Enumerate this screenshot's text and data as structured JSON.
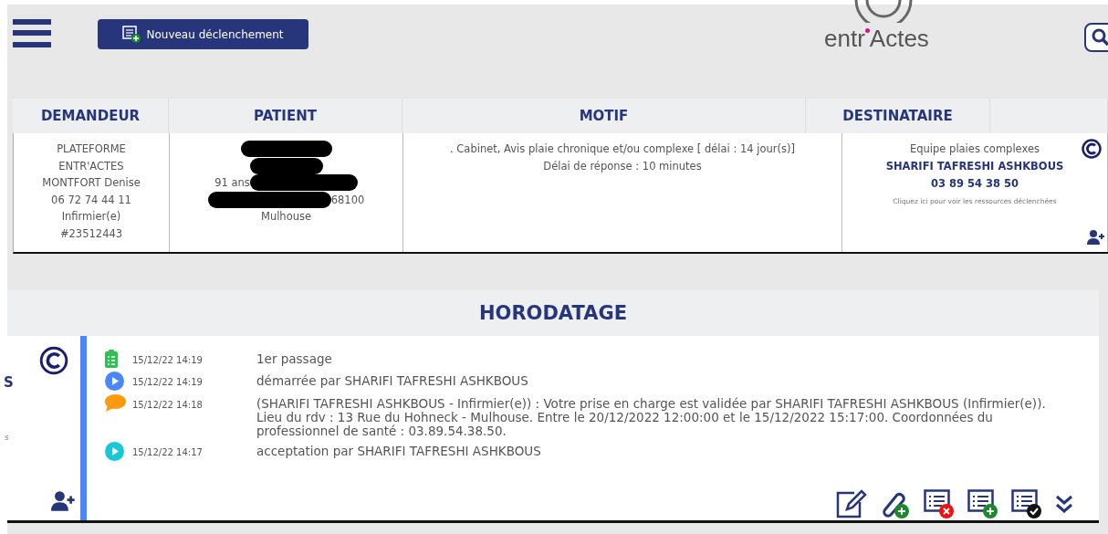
{
  "header": {
    "new_button": "Nouveau déclenchement",
    "logo": {
      "left": "entr",
      "right": "Actes"
    }
  },
  "request_table": {
    "columns": [
      "DEMANDEUR",
      "PATIENT",
      "MOTIF",
      "DESTINATAIRE"
    ],
    "demandeur": [
      "PLATEFORME",
      "ENTR'ACTES",
      "MONTFORT Denise",
      "06 72 74 44 11",
      "Infirmier(e)",
      "#23512443"
    ],
    "patient": {
      "age": "91 ans",
      "postcode": "68100",
      "city": "Mulhouse"
    },
    "motif": [
      ". Cabinet, Avis plaie chronique et/ou complexe [ délai : 14 jour(s)]",
      "Délai de réponse : 10 minutes"
    ],
    "destinataire": {
      "team": "Equipe plaies complexes",
      "name": "SHARIFI TAFRESHI ASHKBOUS",
      "phone": "03 89 54 38 50",
      "link": "Cliquez ici pour voir les ressources déclenchées"
    }
  },
  "horodatage": {
    "title": "HORODATAGE",
    "side_fragments": [
      "S",
      "s"
    ],
    "events": [
      {
        "kind": "clipboard",
        "time": "15/12/22 14:19",
        "text": "1er passage"
      },
      {
        "kind": "start",
        "time": "15/12/22 14:19",
        "text": "démarrée par SHARIFI TAFRESHI ASHKBOUS"
      },
      {
        "kind": "comment",
        "time": "15/12/22 14:18",
        "text": "(SHARIFI TAFRESHI ASHKBOUS - Infirmier(e)) : Votre prise en charge est validée par SHARIFI TAFRESHI ASHKBOUS (Infirmier(e)). Lieu du rdv : 13 Rue du Hohneck - Mulhouse. Entre le 20/12/2022 12:00:00 et le 15/12/2022 15:17:00. Coordonnées du professionnel de santé : 03.89.54.38.50."
      },
      {
        "kind": "accept",
        "time": "15/12/22 14:17",
        "text": "acceptation par SHARIFI TAFRESHI ASHKBOUS"
      }
    ]
  }
}
